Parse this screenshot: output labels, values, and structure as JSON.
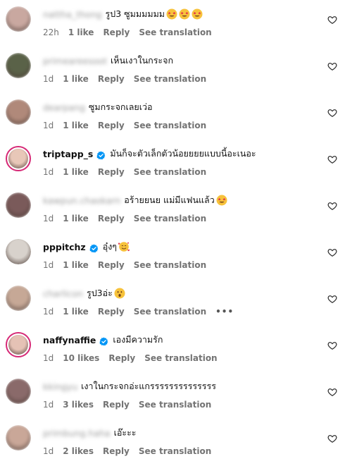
{
  "comments": [
    {
      "username": "nattha_thong",
      "blurred": true,
      "verified": false,
      "story": false,
      "text": "รูป3 ซูมมมมมม",
      "emojis": [
        "star-struck",
        "star-struck",
        "star-struck"
      ],
      "time": "22h",
      "likes": "1 like",
      "reply": "Reply",
      "translate": "See translation",
      "more": false,
      "avatar_color": "#c9a8a0"
    },
    {
      "username": "primeareesoot",
      "blurred": true,
      "verified": false,
      "story": false,
      "text": "เห็นเงาในกระจก",
      "emojis": [],
      "time": "1d",
      "likes": "1 like",
      "reply": "Reply",
      "translate": "See translation",
      "more": false,
      "avatar_color": "#5a6248"
    },
    {
      "username": "dearpang",
      "blurred": true,
      "verified": false,
      "story": false,
      "text": "ซูมกระจกเลยเว่อ",
      "emojis": [],
      "time": "1d",
      "likes": "1 like",
      "reply": "Reply",
      "translate": "See translation",
      "more": false,
      "avatar_color": "#b0897a"
    },
    {
      "username": "triptapp_s",
      "blurred": false,
      "verified": true,
      "story": true,
      "text": "มันก็จะตัวเล็กตัวน้อยยยยแบบนี้อะเนอะ",
      "emojis": [],
      "time": "1d",
      "likes": "1 like",
      "reply": "Reply",
      "translate": "See translation",
      "more": false,
      "avatar_color": "#e8c7b8"
    },
    {
      "username": "kawpun.chaokarn",
      "blurred": true,
      "verified": false,
      "story": false,
      "text": "อร้ายยนย แม่มีแฟนแล้ว",
      "emojis": [
        "star-struck"
      ],
      "time": "1d",
      "likes": "1 like",
      "reply": "Reply",
      "translate": "See translation",
      "more": false,
      "avatar_color": "#7a5a5a"
    },
    {
      "username": "pppitchz",
      "blurred": false,
      "verified": true,
      "story": false,
      "text": "อุ๋งๆ",
      "emojis": [
        "smiling-hearts"
      ],
      "time": "1d",
      "likes": "1 like",
      "reply": "Reply",
      "translate": "See translation",
      "more": false,
      "avatar_color": "#d8d2cc"
    },
    {
      "username": "charlicon",
      "blurred": true,
      "verified": false,
      "story": false,
      "text": "รูป3อ่ะ",
      "emojis": [
        "surprised"
      ],
      "time": "1d",
      "likes": "1 like",
      "reply": "Reply",
      "translate": "See translation",
      "more": true,
      "avatar_color": "#c6a896"
    },
    {
      "username": "naffynaffie",
      "blurred": false,
      "verified": true,
      "story": true,
      "text": "เองมีความรัก",
      "emojis": [],
      "time": "1d",
      "likes": "10 likes",
      "reply": "Reply",
      "translate": "See translation",
      "more": false,
      "avatar_color": "#e5c2b5"
    },
    {
      "username": "kkingyu",
      "blurred": true,
      "verified": false,
      "story": false,
      "text": "เงาในกระจกอ่ะแกรรรรรรรรรรรรรร",
      "emojis": [],
      "time": "1d",
      "likes": "3 likes",
      "reply": "Reply",
      "translate": "See translation",
      "more": false,
      "avatar_color": "#8a6a6a"
    },
    {
      "username": "primbung.haha",
      "blurred": true,
      "verified": false,
      "story": false,
      "text": "เอ๊ะะะ",
      "emojis": [],
      "time": "1d",
      "likes": "2 likes",
      "reply": "Reply",
      "translate": "See translation",
      "more": false,
      "avatar_color": "#c9a798"
    }
  ],
  "colors": {
    "story_ring": "#d62976",
    "verified": "#0095f6",
    "meta": "#737373",
    "heart_stroke": "#262626"
  },
  "icons": {
    "verified": "verified-badge-icon",
    "heart": "heart-outline-icon",
    "more": "more-options-icon"
  }
}
